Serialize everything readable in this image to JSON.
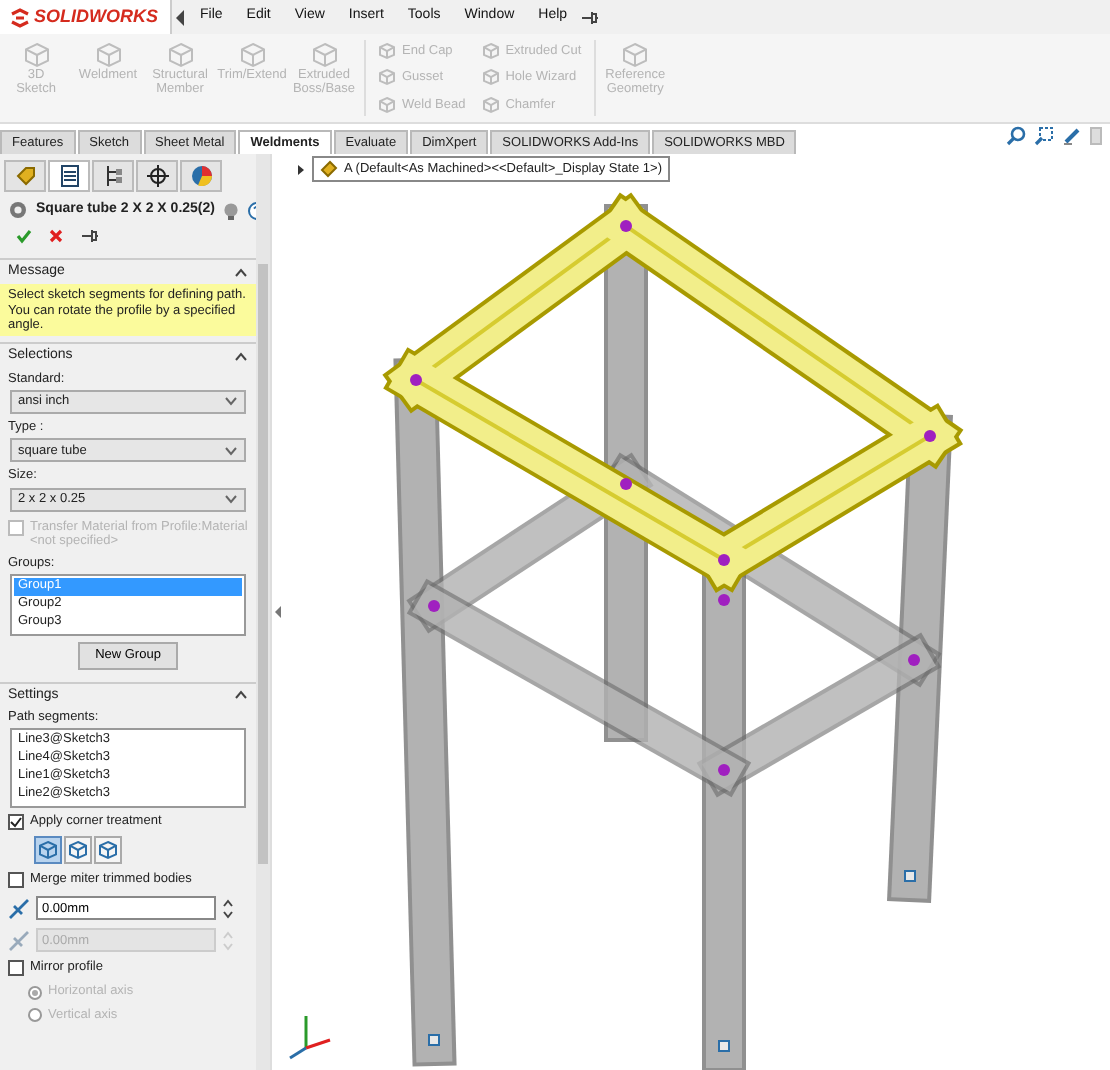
{
  "app": {
    "logo": "SOLIDWORKS",
    "menu": [
      "File",
      "Edit",
      "View",
      "Insert",
      "Tools",
      "Window",
      "Help"
    ]
  },
  "toolbar": [
    {
      "kind": "large",
      "label": "3D Sketch",
      "disabled": true
    },
    {
      "kind": "large",
      "label": "Weldment",
      "disabled": true
    },
    {
      "kind": "large",
      "label": "Structural Member",
      "disabled": true
    },
    {
      "kind": "large",
      "label": "Trim/Extend",
      "disabled": true
    },
    {
      "kind": "large",
      "label": "Extruded Boss/Base",
      "disabled": true
    },
    {
      "kind": "stack",
      "items": [
        {
          "label": "End Cap",
          "disabled": true
        },
        {
          "label": "Gusset",
          "disabled": true
        },
        {
          "label": "Weld Bead",
          "disabled": true
        }
      ]
    },
    {
      "kind": "stack",
      "items": [
        {
          "label": "Extruded Cut",
          "disabled": true
        },
        {
          "label": "Hole Wizard",
          "disabled": true
        },
        {
          "label": "Chamfer",
          "disabled": true
        }
      ]
    },
    {
      "kind": "large",
      "label": "Reference Geometry",
      "disabled": true
    }
  ],
  "tabs": [
    {
      "label": "Features",
      "selected": false
    },
    {
      "label": "Sketch",
      "selected": false
    },
    {
      "label": "Sheet Metal",
      "selected": false
    },
    {
      "label": "Weldments",
      "selected": true
    },
    {
      "label": "Evaluate",
      "selected": false
    },
    {
      "label": "DimXpert",
      "selected": false
    },
    {
      "label": "SOLIDWORKS Add-Ins",
      "selected": false
    },
    {
      "label": "SOLIDWORKS MBD",
      "selected": false
    }
  ],
  "panel_tabs": [
    {
      "selected": false
    },
    {
      "selected": true
    },
    {
      "selected": false
    },
    {
      "selected": false
    },
    {
      "selected": false
    }
  ],
  "property_manager": {
    "title": "Square tube 2 X 2 X 0.25(2)",
    "message": {
      "title": "Message",
      "text": "Select sketch segments for defining path. You can rotate the profile by a specified angle."
    },
    "selections": {
      "title": "Selections",
      "standard": {
        "label": "Standard:",
        "value": "ansi inch"
      },
      "type": {
        "label": "Type :",
        "value": "square tube"
      },
      "size": {
        "label": "Size:",
        "value": "2 x 2 x 0.25"
      },
      "transfer_material": {
        "label": "Transfer Material from Profile:Material <not specified>",
        "checked": false,
        "disabled": true
      },
      "groups_label": "Groups:",
      "groups": [
        {
          "label": "Group1",
          "selected": true
        },
        {
          "label": "Group2",
          "selected": false
        },
        {
          "label": "Group3",
          "selected": false
        }
      ],
      "new_group": "New Group"
    },
    "settings": {
      "title": "Settings",
      "path_label": "Path segments:",
      "path_segments": [
        "Line3@Sketch3",
        "Line4@Sketch3",
        "Line1@Sketch3",
        "Line2@Sketch3"
      ],
      "corner_treatment": {
        "label": "Apply corner treatment",
        "checked": true
      },
      "corner_types": [
        {
          "selected": true
        },
        {
          "selected": false
        },
        {
          "selected": false
        }
      ],
      "merge_miter": {
        "label": "Merge miter trimmed bodies",
        "checked": false
      },
      "gap_fields": [
        {
          "value": "0.00mm",
          "disabled": false
        },
        {
          "value": "0.00mm",
          "disabled": true
        }
      ],
      "mirror_profile": {
        "label": "Mirror profile",
        "checked": false
      },
      "axes": [
        {
          "label": "Horizontal axis",
          "selected": true,
          "disabled": true
        },
        {
          "label": "Vertical axis",
          "selected": false,
          "disabled": true
        }
      ]
    }
  },
  "viewport": {
    "tree_item": "A  (Default<As Machined><<Default>_Display State 1>)"
  }
}
